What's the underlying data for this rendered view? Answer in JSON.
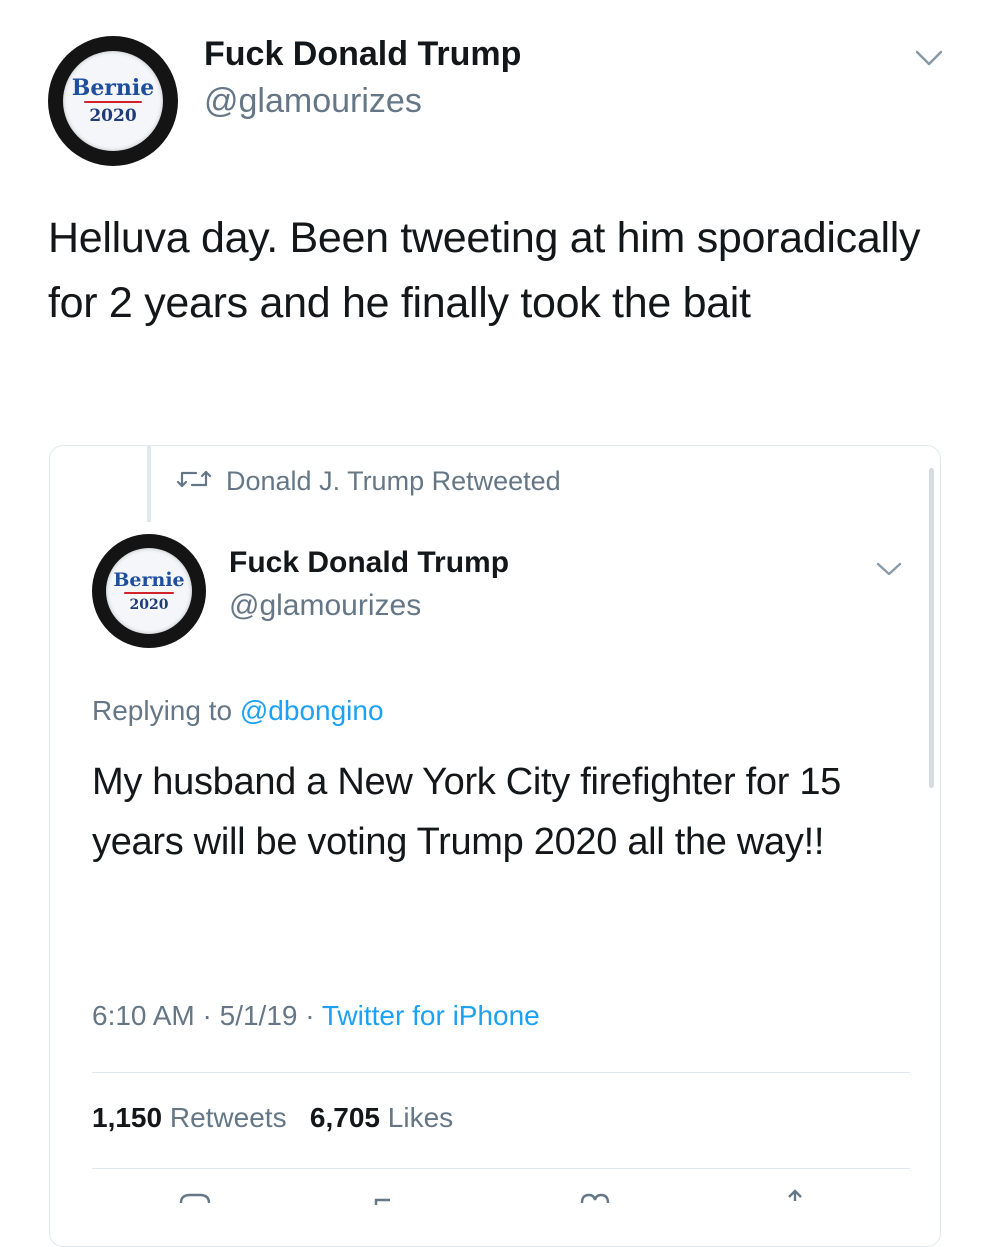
{
  "tweet": {
    "display_name": "Fuck Donald Trump",
    "handle": "@glamourizes",
    "avatar": {
      "badge_name": "Bernie",
      "badge_year": "2020"
    },
    "text": "Helluva day. Been tweeting at him sporadically for 2 years and he finally took the bait"
  },
  "quoted": {
    "retweeted_by": "Donald J. Trump Retweeted",
    "display_name": "Fuck Donald Trump",
    "handle": "@glamourizes",
    "avatar": {
      "badge_name": "Bernie",
      "badge_year": "2020"
    },
    "replying_label": "Replying to",
    "replying_handle": "@dbongino",
    "text": "My husband a New York City firefighter for 15 years will be voting Trump 2020 all the way!!",
    "time": "6:10 AM",
    "date": "5/1/19",
    "separator": "·",
    "source": "Twitter for iPhone",
    "retweets_count": "1,150",
    "retweets_label": "Retweets",
    "likes_count": "6,705",
    "likes_label": "Likes"
  },
  "colors": {
    "link": "#1da1f2",
    "secondary_text": "#657786",
    "avatar_ring": "#141414",
    "badge_blue": "#1f4f9c",
    "badge_red": "#d2232a"
  },
  "icons": [
    "chevron-down-icon",
    "retweet-icon",
    "reply-icon",
    "like-icon",
    "share-icon"
  ]
}
